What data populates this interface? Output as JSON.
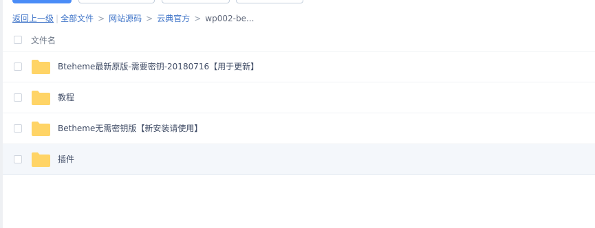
{
  "breadcrumb": {
    "back": "返回上一级",
    "items": [
      "全部文件",
      "网站源码",
      "云典官方"
    ],
    "current": "wp002-be..."
  },
  "list": {
    "header": "文件名",
    "items": [
      {
        "name": "Bteheme最新原版-需要密钥-20180716【用于更新】"
      },
      {
        "name": "教程"
      },
      {
        "name": "Betheme无需密钥版【新安装请使用】"
      },
      {
        "name": "插件"
      }
    ]
  },
  "colors": {
    "folder": "#ffd466",
    "link": "#3f74c8",
    "primary": "#4a8cf7"
  }
}
